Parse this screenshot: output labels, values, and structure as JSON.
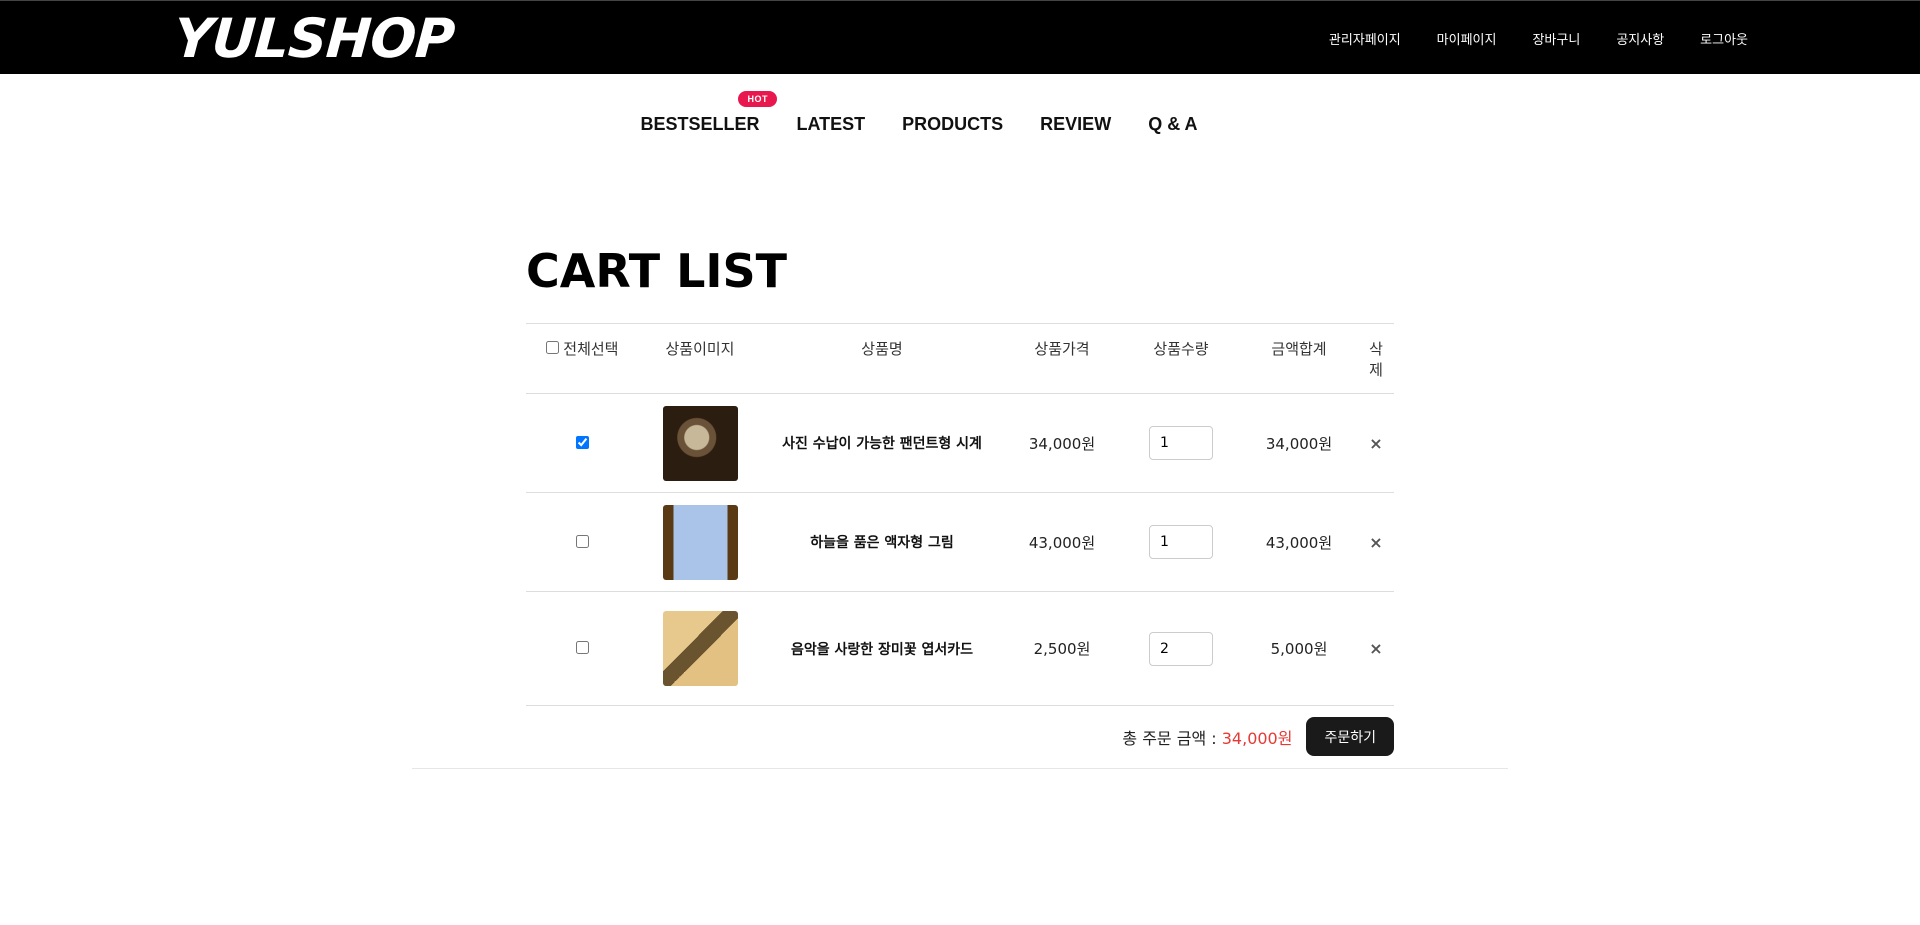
{
  "brand": "YULSHOP",
  "top_nav": [
    "관리자페이지",
    "마이페이지",
    "장바구니",
    "공지사항",
    "로그아웃"
  ],
  "main_nav": [
    "BESTSELLER",
    "LATEST",
    "PRODUCTS",
    "REVIEW",
    "Q & A"
  ],
  "hot_badge": "HOT",
  "page_title": "CART LIST",
  "table_headers": {
    "select_all": "전체선택",
    "image": "상품이미지",
    "name": "상품명",
    "price": "상품가격",
    "qty": "상품수량",
    "total": "금액합계",
    "delete": "삭제"
  },
  "items": [
    {
      "name": "사진 수납이 가능한 팬던트형 시계",
      "price": "34,000원",
      "qty": "1",
      "total": "34,000원",
      "checked": true
    },
    {
      "name": "하늘을 품은 액자형 그림",
      "price": "43,000원",
      "qty": "1",
      "total": "43,000원",
      "checked": false
    },
    {
      "name": "음악을 사랑한 장미꽃 엽서카드",
      "price": "2,500원",
      "qty": "2",
      "total": "5,000원",
      "checked": false
    }
  ],
  "summary": {
    "label": "총 주문 금액 :",
    "value": "34,000원"
  },
  "order_button": "주문하기",
  "delete_symbol": "×",
  "colors": {
    "topbar": "#000000",
    "hot_badge": "#e8174d",
    "total_value": "#e53935",
    "order_button": "#1a1a1a"
  }
}
